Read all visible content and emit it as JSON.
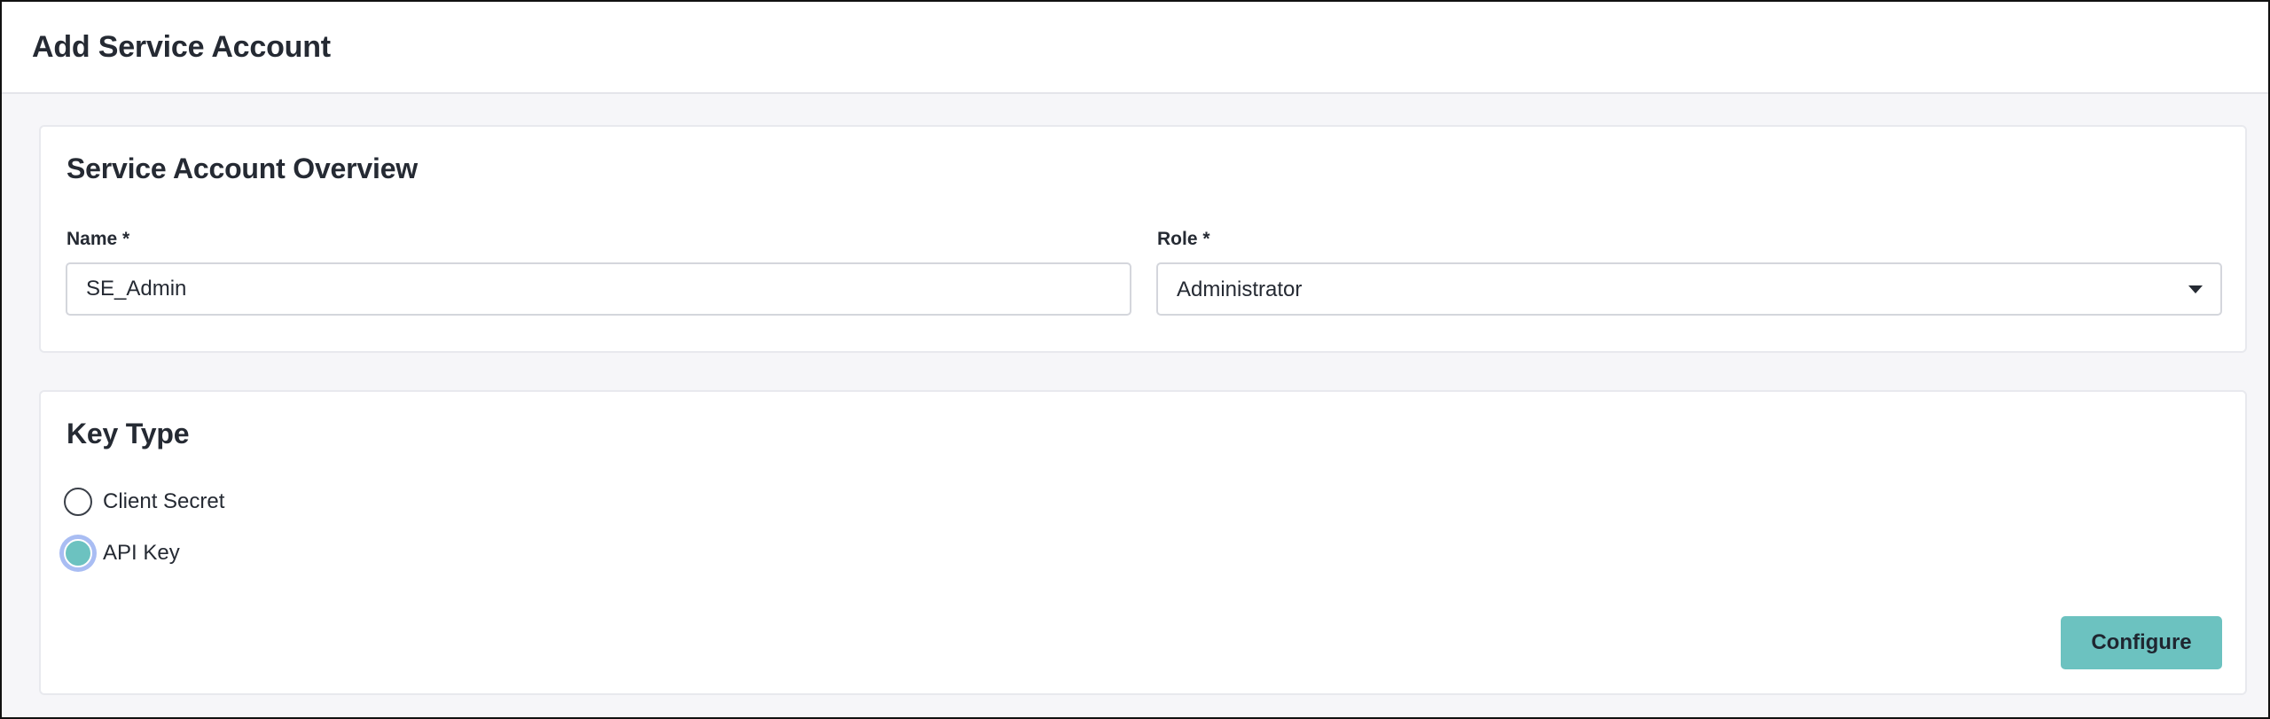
{
  "header": {
    "title": "Add Service Account"
  },
  "overview": {
    "title": "Service Account Overview",
    "name_label": "Name *",
    "name_value": "SE_Admin",
    "role_label": "Role *",
    "role_value": "Administrator"
  },
  "key_type": {
    "title": "Key Type",
    "options": [
      {
        "label": "Client Secret",
        "selected": false
      },
      {
        "label": "API Key",
        "selected": true
      }
    ],
    "configure_label": "Configure"
  },
  "colors": {
    "accent": "#6cc2c0",
    "focus_ring": "#a9bdf3",
    "page_background": "#f6f6f9",
    "text": "#252a33"
  },
  "icons": {
    "role_dropdown": "caret-down-icon"
  }
}
